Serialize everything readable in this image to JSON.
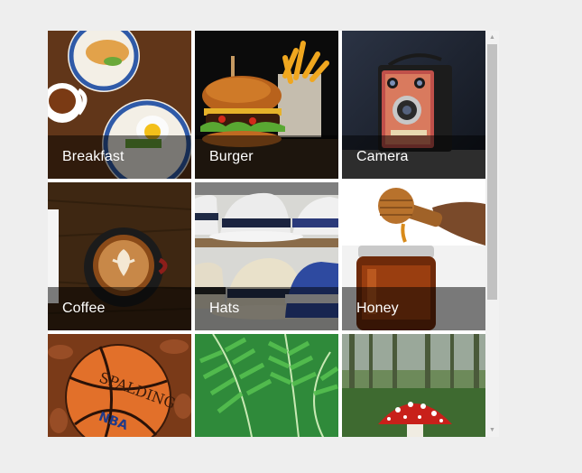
{
  "image_list": {
    "tiles": [
      {
        "title": "Breakfast",
        "image_icon": "breakfast-photo"
      },
      {
        "title": "Burger",
        "image_icon": "burger-photo"
      },
      {
        "title": "Camera",
        "image_icon": "camera-photo"
      },
      {
        "title": "Coffee",
        "image_icon": "coffee-photo"
      },
      {
        "title": "Hats",
        "image_icon": "hats-photo"
      },
      {
        "title": "Honey",
        "image_icon": "honey-photo"
      },
      {
        "title": "",
        "image_icon": "basketball-photo"
      },
      {
        "title": "",
        "image_icon": "fern-photo"
      },
      {
        "title": "",
        "image_icon": "mushroom-photo"
      }
    ]
  },
  "scrollbar": {
    "up_arrow": "▲",
    "down_arrow": "▼",
    "scroll_position": 0.0
  }
}
